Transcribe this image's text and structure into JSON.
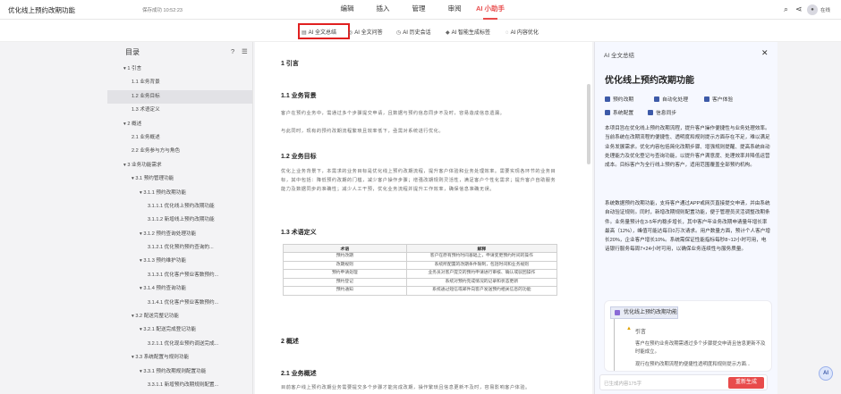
{
  "app": {
    "title": "优化线上预约改期功能",
    "saved": "保存成功 10:52:23"
  },
  "menu": [
    "编辑",
    "插入",
    "管理",
    "审阅",
    "AI 小助手"
  ],
  "share_label": "在线",
  "toolbar": [
    "AI 全文总结",
    "AI 全文问答",
    "AI 历史会话",
    "AI 智能生成标签",
    "AI 内容优化"
  ],
  "sidebar": {
    "title": "目录",
    "items": [
      {
        "label": "▾ 1 引言",
        "indent": 0
      },
      {
        "label": "1.1 业务背景",
        "indent": 1
      },
      {
        "label": "1.2 业务目标",
        "indent": 1,
        "selected": true
      },
      {
        "label": "1.3 术语定义",
        "indent": 1
      },
      {
        "label": "▾ 2 概述",
        "indent": 0
      },
      {
        "label": "2.1 业务概述",
        "indent": 1
      },
      {
        "label": "2.2 业务参与方与角色",
        "indent": 1
      },
      {
        "label": "▾ 3 业务功能需求",
        "indent": 0
      },
      {
        "label": "▾ 3.1 预约管理功能",
        "indent": 1
      },
      {
        "label": "▾ 3.1.1 预约改期功能",
        "indent": 2
      },
      {
        "label": "3.1.1.1 优化线上预约改期功能",
        "indent": 3
      },
      {
        "label": "3.1.1.2 新增线上预约改期功能",
        "indent": 3
      },
      {
        "label": "▾ 3.1.2 预约查询处理功能",
        "indent": 2
      },
      {
        "label": "3.1.2.1 优化预约预约查询的...",
        "indent": 3
      },
      {
        "label": "▾ 3.1.3 预约维护功能",
        "indent": 2
      },
      {
        "label": "3.1.3.1 优化客户预业客数预约...",
        "indent": 3
      },
      {
        "label": "▾ 3.1.4 预约查询功能",
        "indent": 2
      },
      {
        "label": "3.1.4.1 优化客户预业客数预约...",
        "indent": 3
      },
      {
        "label": "▾ 3.2 配送完整记功能",
        "indent": 1
      },
      {
        "label": "▾ 3.2.1 配送完成登记功能",
        "indent": 2
      },
      {
        "label": "3.2.1.1 优化现业预约调送完成...",
        "indent": 3
      },
      {
        "label": "▾ 3.3 系统配置与规则功能",
        "indent": 1
      },
      {
        "label": "▾ 3.3.1 预约改期规则配置功能",
        "indent": 2
      },
      {
        "label": "3.3.1.1 新增预约改期规则配置...",
        "indent": 3
      },
      {
        "label": "▸ 4 非功能需求",
        "indent": 0
      }
    ]
  },
  "doc": {
    "h1": "1 引言",
    "h11": "1.1 业务背景",
    "p1": "客户在预约业务中，需通过多个步骤提交申请，且数据与预约信息同步不及时，容易造成信息遗漏。",
    "p1b": "与此同时，现有的预约改期流程繁琐且效率低下，亟需对系统进行优化。",
    "h12": "1.2 业务目标",
    "p2": "优化上业务背景下，本需求的业务目标是优化线上预约改期流程，提升客户体验和业务处理效率。需要实现各环节的业务目标，其中包括：降低预约改期的门槛，减少客户操作步骤；增强改期规则灵活性，满足客户个性化需求；提升客户自助服务能力及数据同步的准确性；减少人工干预，优化业务流程并提升工作效率，确保信息准确无误。",
    "h13": "1.3 术语定义",
    "table_headers": [
      "术语",
      "解释"
    ],
    "table_rows": [
      [
        "预约改期",
        "客户在原有预约时间基础上，申请变更预约时间的操作"
      ],
      [
        "改期规则",
        "系统所配置的改期条件限制，包括时间和业务规则"
      ],
      [
        "预约申请处理",
        "业务员对客户提交的预约申请进行审核、确认或驳回操作"
      ],
      [
        "预约登记",
        "系统对预约完成情况的记录和状态更新"
      ],
      [
        "预约通知",
        "系统通过短信或邮件向客户发送预约相关信息的功能"
      ]
    ],
    "h2": "2 概述",
    "h21": "2.1 业务概述",
    "p3": "目前客户线上预约改期业务需要提交多个步骤才能完成改期，操作繁琐且信息更新不及时，容易影响客户体验。"
  },
  "panel": {
    "header": "AI 全文总结",
    "title": "优化线上预约改期功能",
    "tags": [
      "预约改期",
      "自动化处理",
      "客户体验",
      "系统配置",
      "信息同步"
    ],
    "para1": "本项目旨在优化线上预约改期流程，提升客户操作便捷性与业务处理效率。当前系统在改期流程的便捷性、透明度和规则提示方面存在不足，难以满足业务发展需求。优化内容包括简化改期步骤、增强规则提醒、提高系统自动处理能力及优化登记与查询功能，以提升客户满意度、处理效率并降低运营成本。目标客户为全行线上预约客户，适用范围覆盖全部预约机构。",
    "para2": "系统数据预约改期功能，支持客户通过APP或网页直接提交申请，并由系统自动验证规则。同时，新增改期规则配置功能，便于管理员灵活调整改期条件。业务量预计在3-5年内稳步增长，其中客户年业务改期申请量年增长率最高（12%），峰值可能达每日0万次请求。用户数量方面，预计个人客户增长20%，企业客户增长10%。系统需保证性能指标每秒8~12小时可用，电话银行服务每周7×24小时可用，以确保业务连续性与服务质量。",
    "mind_root": "优化线上预约改期功能",
    "mind_ref": "引言",
    "mind_t1": "客户在预约业务改期需通过多个步骤提交申请且信息更新不及时能成立。",
    "mind_t2": "现行在预约改期流程的便捷性透明度和规则提示方面...",
    "input_placeholder": "已生成内容175字",
    "gen_button": "重新生成"
  }
}
